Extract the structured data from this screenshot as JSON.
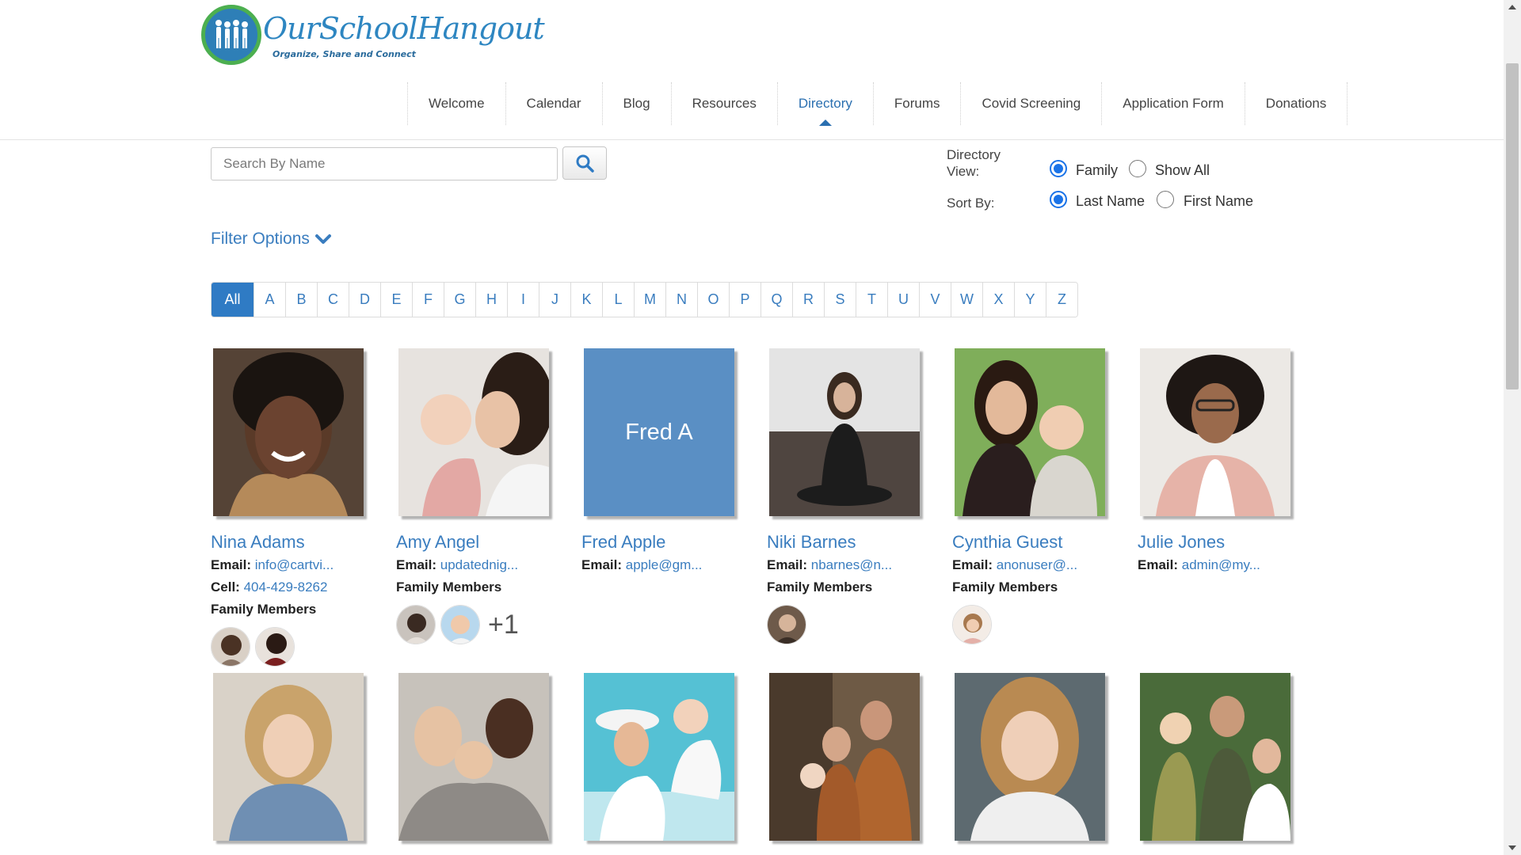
{
  "brand": {
    "name": "OurSchoolHangout",
    "tagline": "Organize, Share and Connect"
  },
  "nav": {
    "items": [
      {
        "label": "Welcome"
      },
      {
        "label": "Calendar"
      },
      {
        "label": "Blog"
      },
      {
        "label": "Resources"
      },
      {
        "label": "Directory",
        "active": true
      },
      {
        "label": "Forums"
      },
      {
        "label": "Covid Screening"
      },
      {
        "label": "Application Form"
      },
      {
        "label": "Donations"
      }
    ]
  },
  "search": {
    "placeholder": "Search By Name",
    "button_icon": "search-icon"
  },
  "directory_view": {
    "label": "Directory View:",
    "options": [
      {
        "label": "Family",
        "checked": true
      },
      {
        "label": "Show All",
        "checked": false
      }
    ]
  },
  "sort_by": {
    "label": "Sort By:",
    "options": [
      {
        "label": "Last Name",
        "checked": true
      },
      {
        "label": "First Name",
        "checked": false
      }
    ]
  },
  "filter": {
    "label": "Filter Options",
    "icon": "chevron-down-icon"
  },
  "alphabet": [
    "All",
    "A",
    "B",
    "C",
    "D",
    "E",
    "F",
    "G",
    "H",
    "I",
    "J",
    "K",
    "L",
    "M",
    "N",
    "O",
    "P",
    "Q",
    "R",
    "S",
    "T",
    "U",
    "V",
    "W",
    "X",
    "Y",
    "Z"
  ],
  "alphabet_selected": "All",
  "cards": [
    {
      "name": "Nina Adams",
      "email_label": "Email:",
      "email": "info@cartvi...",
      "cell_label": "Cell:",
      "cell": "404-429-8262",
      "family_label": "Family Members",
      "family_count": 2,
      "extra": ""
    },
    {
      "name": "Amy Angel",
      "email_label": "Email:",
      "email": "updatednig...",
      "family_label": "Family Members",
      "family_count": 2,
      "extra": "+1"
    },
    {
      "name": "Fred Apple",
      "email_label": "Email:",
      "email": "apple@gm...",
      "placeholder_text": "Fred A"
    },
    {
      "name": "Niki Barnes",
      "email_label": "Email:",
      "email": "nbarnes@n...",
      "family_label": "Family Members",
      "family_count": 1,
      "extra": ""
    },
    {
      "name": "Cynthia Guest",
      "email_label": "Email:",
      "email": "anonuser@...",
      "family_label": "Family Members",
      "family_count": 1,
      "extra": ""
    },
    {
      "name": "Julie Jones",
      "email_label": "Email:",
      "email": "admin@my..."
    }
  ],
  "colors": {
    "accent": "#3a7dbf",
    "active_alpha": "#2f7bc4",
    "placeholder_tile": "#5a8fc4",
    "logo_green": "#4caf50"
  }
}
